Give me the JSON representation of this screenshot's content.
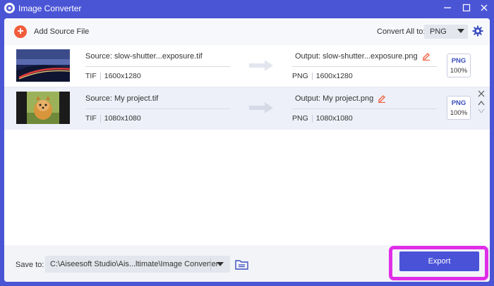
{
  "window": {
    "title": "Image Converter",
    "accent": "#4a55d6"
  },
  "toolbar": {
    "add_label": "Add Source File",
    "convert_all_label": "Convert All to:",
    "convert_all_value": "PNG"
  },
  "files": [
    {
      "source": "Source: slow-shutter...exposure.tif",
      "src_format": "TIF",
      "src_size": "1600x1280",
      "output": "Output: slow-shutter...exposure.png",
      "out_format": "PNG",
      "out_size": "1600x1280",
      "fmt": "PNG",
      "quality": "100%"
    },
    {
      "source": "Source: My project.tif",
      "src_format": "TIF",
      "src_size": "1080x1080",
      "output": "Output: My project.png",
      "out_format": "PNG",
      "out_size": "1080x1080",
      "fmt": "PNG",
      "quality": "100%"
    }
  ],
  "footer": {
    "save_label": "Save to:",
    "path": "C:\\Aiseesoft Studio\\Ais...ltimate\\Image Converter",
    "export_label": "Export",
    "highlight_color": "#e02ee8"
  },
  "icons": {
    "logo": "app-logo-icon",
    "add": "plus-circle-icon",
    "settings": "gear-icon",
    "edit": "pencil-icon",
    "arrow": "right-arrow-icon",
    "folder": "folder-icon"
  }
}
